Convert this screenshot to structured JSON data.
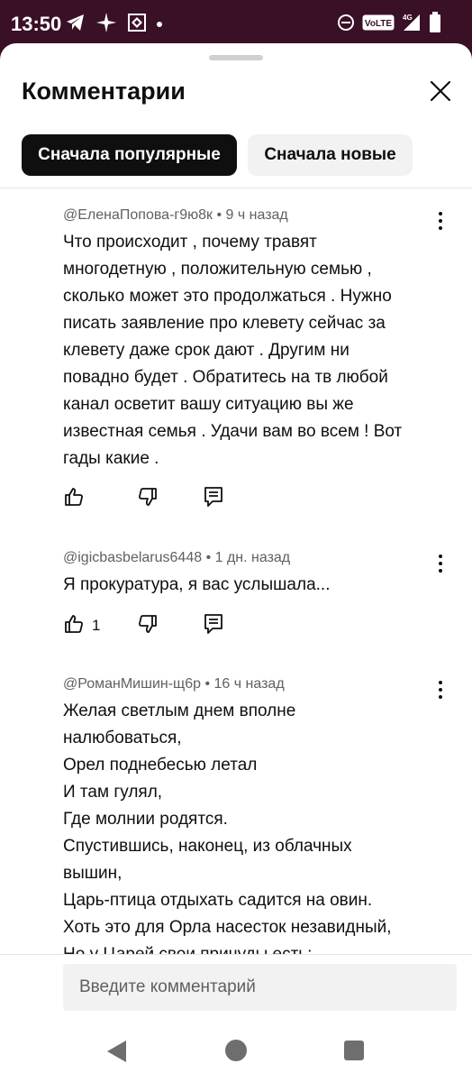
{
  "status_bar": {
    "time": "13:50",
    "left_icons": [
      "telegram-icon",
      "sparkle-icon",
      "app-icon",
      "dot-icon"
    ],
    "right_icons": [
      "do-not-disturb-icon",
      "volte-icon",
      "signal-4g-icon",
      "battery-icon"
    ],
    "volte_label": "VoLTE",
    "network_label": "4G"
  },
  "header": {
    "title": "Комментарии",
    "close_icon": "close-icon"
  },
  "sort_chips": {
    "popular": "Сначала популярные",
    "new": "Сначала новые"
  },
  "comments": [
    {
      "meta": "@ЕленаПопова-г9ю8к • 9 ч назад",
      "lines": [
        "Что происходит , почему травят",
        "многодетную , положительную семью ,",
        "сколько может это продолжаться . Нужно",
        "писать заявление про клевету сейчас за",
        "клевету даже срок дают . Другим ни",
        "повадно будет . Обратитесь на тв любой",
        "канал осветит вашу ситуацию вы же",
        "известная семья . Удачи вам во всем ! Вот",
        "гады какие ."
      ],
      "likes": ""
    },
    {
      "meta": "@igicbasbelarus6448 • 1 дн. назад",
      "lines": [
        "Я прокуратура, я вас услышала..."
      ],
      "likes": "1"
    },
    {
      "meta": "@РоманМишин-щ6р • 16 ч назад",
      "lines": [
        "Желая светлым днем вполне",
        "налюбоваться,",
        "Орел поднебесью летал",
        "И там гулял,",
        "Где молнии родятся.",
        "Спустившись, наконец, из облачных",
        "вышин,",
        "Царь-птица отдыхать садится на овин.",
        "Хоть это для Орла насесток незавидный,",
        "Но у Царей свои причуды есть:"
      ],
      "likes": ""
    }
  ],
  "composer": {
    "placeholder": "Введите комментарий"
  },
  "nav_bar": {
    "icons": [
      "back-icon",
      "home-icon",
      "recent-apps-icon"
    ]
  }
}
